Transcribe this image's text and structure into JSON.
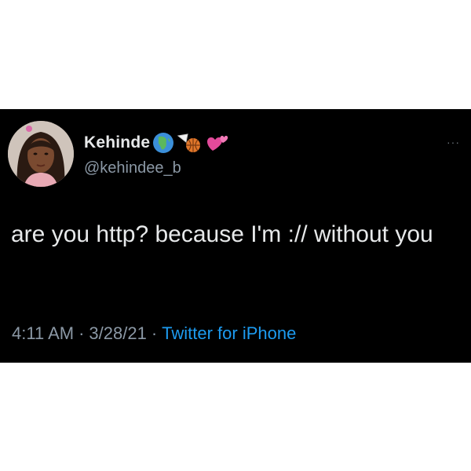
{
  "tweet": {
    "display_name": "Kehinde",
    "handle": "@kehindee_b",
    "emojis": [
      "globe-africa-icon",
      "basketball-hoop-icon",
      "two-hearts-icon"
    ],
    "more_label": "···",
    "text": "are you http? because I'm :// without you",
    "time": "4:11 AM",
    "separator": "·",
    "date": "3/28/21",
    "source": "Twitter for iPhone"
  },
  "colors": {
    "card_background": "#000000",
    "page_background": "#ffffff",
    "primary_text": "#e7e9ea",
    "secondary_text": "#8b98a5",
    "link": "#1d9bf0"
  }
}
